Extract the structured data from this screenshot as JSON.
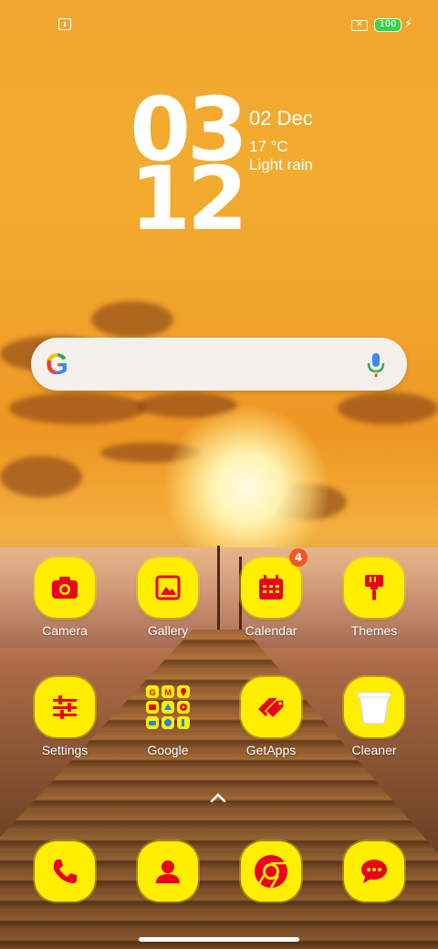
{
  "status_bar": {
    "battery_level": "100",
    "battery_color": "#3bd34a"
  },
  "clock": {
    "hour": "03",
    "minute": "12"
  },
  "weather": {
    "date": "02 Dec",
    "temperature": "17 °C",
    "condition": "Light rain"
  },
  "search_bar": {
    "logo": "G",
    "mic_icon": "mic-icon"
  },
  "apps_row1": [
    {
      "label": "Camera",
      "icon": "camera-icon"
    },
    {
      "label": "Gallery",
      "icon": "image-icon"
    },
    {
      "label": "Calendar",
      "icon": "calendar-icon",
      "badge": "4"
    },
    {
      "label": "Themes",
      "icon": "paintbrush-icon"
    }
  ],
  "apps_row2": [
    {
      "label": "Settings",
      "icon": "sliders-icon"
    },
    {
      "label": "Google",
      "icon": "folder-icon"
    },
    {
      "label": "GetApps",
      "icon": "tags-icon"
    },
    {
      "label": "Cleaner",
      "icon": "trash-bin-icon"
    }
  ],
  "dock": [
    {
      "icon": "phone-icon"
    },
    {
      "icon": "contacts-icon"
    },
    {
      "icon": "chrome-icon"
    },
    {
      "icon": "messages-icon"
    }
  ],
  "colors": {
    "icon_tile": "#ffee00",
    "icon_glyph": "#e8001c",
    "badge": "#f05a24"
  }
}
